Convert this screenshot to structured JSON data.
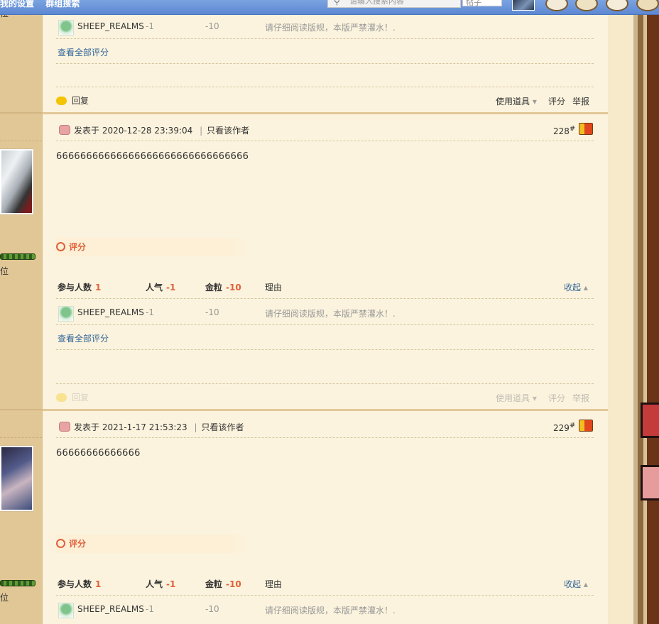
{
  "topbar": {
    "links": [
      "我的设置",
      "群组搜索"
    ],
    "search_placeholder": "请输入搜索内容",
    "search_type": "帖子",
    "search_icon": "search-icon"
  },
  "sidebar": {
    "label1": "位",
    "label2": "位",
    "top_label": "位"
  },
  "prev_rating": {
    "user": "SHEEP_REALMS",
    "popularity": "-1",
    "coins": "-10",
    "reason": "请仔细阅读版规，本版严禁灌水！.",
    "view_all": "查看全部评分"
  },
  "reply1": {
    "reply": "回复",
    "use_item": "使用道具",
    "rate": "评分",
    "report": "举报"
  },
  "posts": [
    {
      "meta": "发表于 2020-12-28 23:39:04",
      "only_author": "只看该作者",
      "floor": "228",
      "floor_sup": "#",
      "body": "66666666666666666666666666666666",
      "rating": {
        "title": "评分",
        "participants_label": "参与人数",
        "participants": "1",
        "pop_label": "人气",
        "pop": "-1",
        "coin_label": "金粒",
        "coin": "-10",
        "reason_label": "理由",
        "collapse": "收起",
        "user": "SHEEP_REALMS",
        "u_pop": "-1",
        "u_coin": "-10",
        "u_reason": "请仔细阅读版规，本版严禁灌水！.",
        "view_all": "查看全部评分"
      },
      "actions": {
        "reply": "回复",
        "use_item": "使用道具",
        "rate": "评分",
        "report": "举报"
      }
    },
    {
      "meta": "发表于 2021-1-17 21:53:23",
      "only_author": "只看该作者",
      "floor": "229",
      "floor_sup": "#",
      "body": "66666666666666",
      "rating": {
        "title": "评分",
        "participants_label": "参与人数",
        "participants": "1",
        "pop_label": "人气",
        "pop": "-1",
        "coin_label": "金粒",
        "coin": "-10",
        "reason_label": "理由",
        "collapse": "收起",
        "user": "SHEEP_REALMS",
        "u_pop": "-1",
        "u_coin": "-10",
        "u_reason": "请仔细阅读版规，本版严禁灌水！."
      }
    }
  ]
}
